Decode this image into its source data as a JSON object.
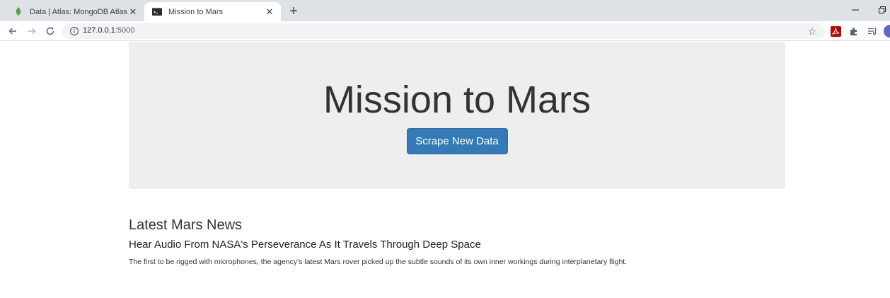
{
  "browser": {
    "tabs": [
      {
        "title": "Data | Atlas: MongoDB Atlas",
        "active": false,
        "favicon": "mongodb-leaf-icon"
      },
      {
        "title": "Mission to Mars",
        "active": true,
        "favicon": "terminal-icon"
      }
    ],
    "new_tab_symbol": "+",
    "close_symbol": "✕",
    "address": {
      "host": "127.0.0.1",
      "port": ":5000"
    },
    "colors": {
      "tabstrip": "#dee1e6",
      "omnibox": "#f1f3f4",
      "avatar": "#5c6bc0"
    }
  },
  "page": {
    "title": "Mission to Mars",
    "scrape_button": "Scrape New Data",
    "news": {
      "section_heading": "Latest Mars News",
      "headline": "Hear Audio From NASA's Perseverance As It Travels Through Deep Space",
      "teaser": "The first to be rigged with microphones, the agency's latest Mars rover picked up the subtle sounds of its own inner workings during interplanetary flight."
    },
    "colors": {
      "jumbotron": "#eeeeee",
      "button": "#337ab7",
      "text": "#333333"
    }
  }
}
